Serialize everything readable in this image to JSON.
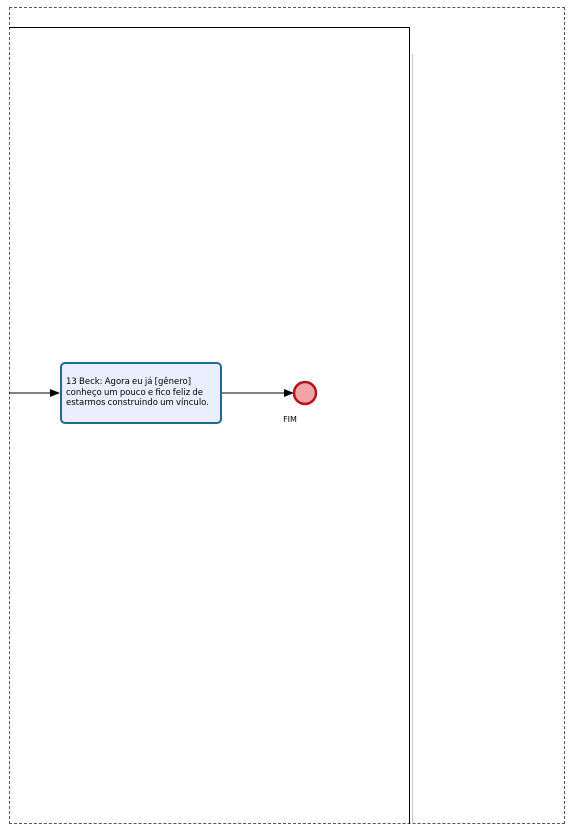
{
  "diagram": {
    "task": {
      "text": "13 Beck: Agora eu já [gênero] conheço um pouco e fico feliz de estarmos construindo um vínculo."
    },
    "end_event": {
      "label": "FIM"
    }
  },
  "colors": {
    "task_fill": "#e9eefc",
    "task_border": "#1f6a92",
    "end_event_fill": "#f0a4a8",
    "end_event_border": "#b3141c",
    "connector": "#000000"
  }
}
